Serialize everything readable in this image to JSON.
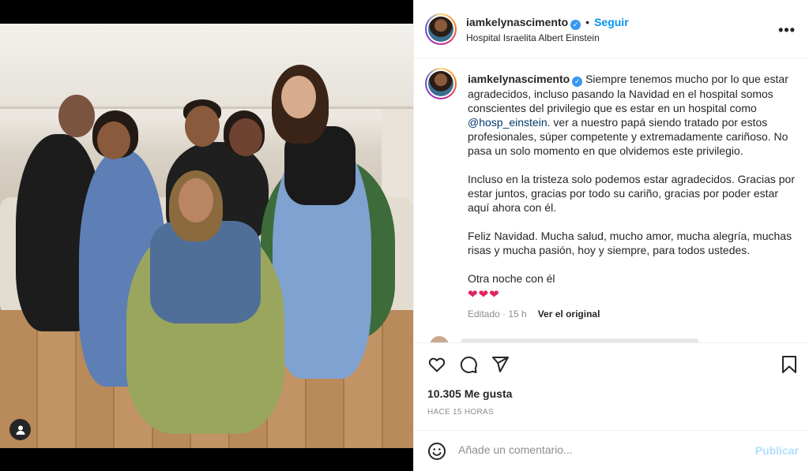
{
  "post": {
    "username": "iamkelynascimento",
    "follow_label": "Seguir",
    "location": "Hospital Israelita Albert Einstein",
    "caption": {
      "p1_before_mention": "Siempre tenemos mucho por lo que estar agradecidos, incluso pasando la Navidad en el hospital somos conscientes del privilegio que es estar en un hospital como",
      "mention": "@hosp_einstein",
      "p1_after_mention": ". ver a nuestro papá siendo tratado por estos profesionales, súper competente y extremadamente cariñoso. No pasa un solo momento en que olvidemos este privilegio.",
      "p2": "Incluso en la tristeza solo podemos estar agradecidos. Gracias por estar juntos, gracias por todo su cariño, gracias por poder estar aquí ahora con él.",
      "p3": "Feliz Navidad. Mucha salud, mucho amor, mucha alegría, muchas risas y mucha pasión, hoy y siempre, para todos ustedes.",
      "p4": "Otra noche con él",
      "hearts": "❤❤❤"
    },
    "meta": {
      "edited": "Editado · 15 h",
      "see_original": "Ver el original"
    },
    "likes": "10.305 Me gusta",
    "time_ago": "HACE 15 HORAS",
    "comment_placeholder": "Añade un comentario...",
    "publish_label": "Publicar"
  },
  "icons": {
    "like": "heart-icon",
    "comment": "comment-icon",
    "share": "paper-plane-icon",
    "save": "bookmark-icon",
    "emoji": "emoji-icon",
    "more": "more-options-icon",
    "tagged_user": "user-icon",
    "verified": "verified-badge-icon"
  },
  "colors": {
    "accent": "#0095f6",
    "verified": "#3897f0",
    "heart": "#e0245e",
    "publish_disabled": "#b2dffc"
  }
}
